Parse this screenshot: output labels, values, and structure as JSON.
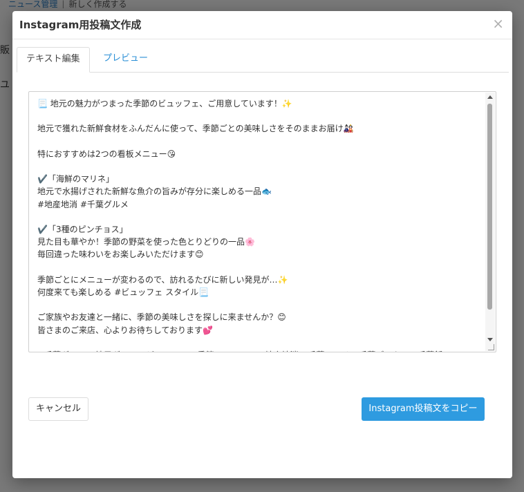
{
  "background": {
    "breadcrumb": [
      "ニュース管理",
      "新しく作成する"
    ],
    "side_text_1": "販",
    "side_text_2": "ユ"
  },
  "modal": {
    "title": "Instagram用投稿文作成",
    "close_glyph": "×",
    "tabs": [
      {
        "label": "テキスト編集",
        "active": true
      },
      {
        "label": "プレビュー",
        "active": false
      }
    ],
    "post_text": "📃 地元の魅力がつまった季節のビュッフェ、ご用意しています！✨\n\n地元で獲れた新鮮食材をふんだんに使って、季節ごとの美味しさをそのままお届け🎎\n\n特におすすめは2つの看板メニュー😘\n\n✔️「海鮮のマリネ」\n地元で水揚げされた新鮮な魚介の旨みが存分に楽しめる一品🐟\n#地産地消 #千葉グルメ\n\n✔️「3種のピンチョス」\n見た目も華やか！季節の野菜を使った色とりどりの一品🌸\n毎回違った味わいをお楽しみいただけます😊\n\n季節ごとにメニューが変わるので、訪れるたびに新しい発見が…✨\n何度来ても楽しめる #ビュッフェ スタイル📃\n\nご家族やお友達と一緒に、季節の美味しさを探しに来ませんか？😊\n皆さまのご来店、心よりお待ちしております💕\n\n#千葉グルメ #地元グルメ #ビュッフェ #季節のメニュー #地産地消 #千葉ランチ #千葉ディナー #千葉飯 #",
    "cancel_label": "キャンセル",
    "copy_label": "Instagram投稿文をコピー"
  },
  "colors": {
    "primary_button": "#2e9be0",
    "tab_link": "#2a8fd6"
  }
}
